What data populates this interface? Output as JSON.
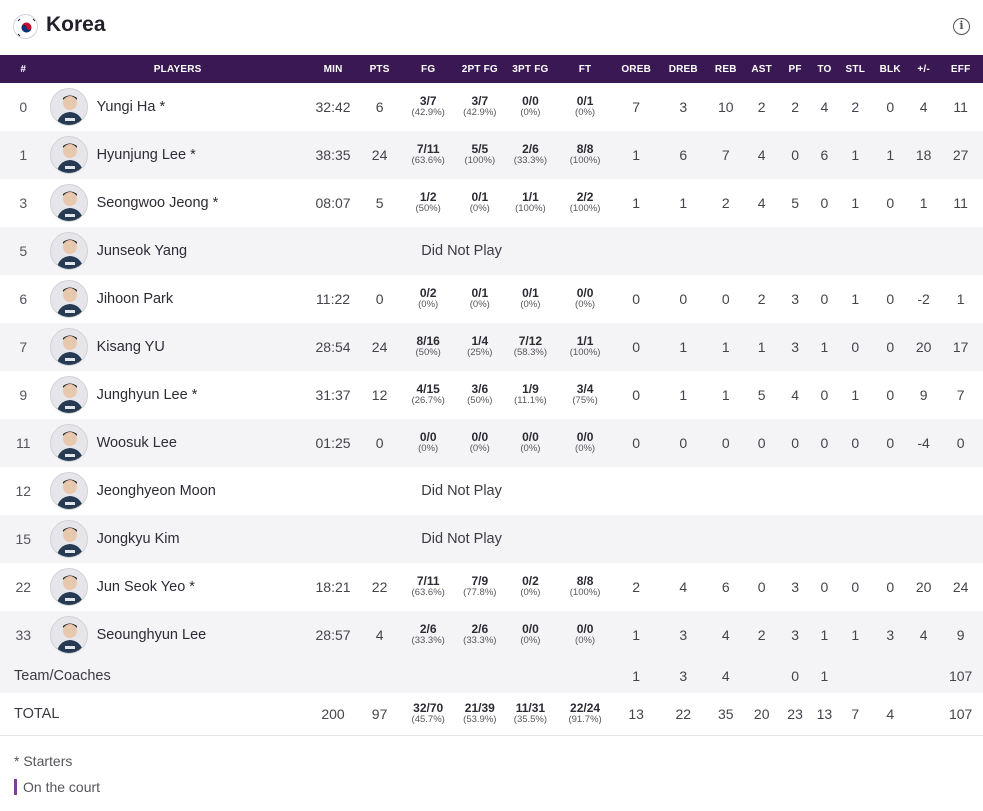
{
  "team": {
    "name": "Korea",
    "info_icon": "info-icon",
    "flag_icon": "korea-flag-icon"
  },
  "headers": [
    "#",
    "PLAYERS",
    "MIN",
    "PTS",
    "FG",
    "2PT FG",
    "3PT FG",
    "FT",
    "OREB",
    "DREB",
    "REB",
    "AST",
    "PF",
    "TO",
    "STL",
    "BLK",
    "+/-",
    "EFF"
  ],
  "players": [
    {
      "no": "0",
      "name": "Yungi Ha",
      "starter": true,
      "min": "32:42",
      "pts": "6",
      "fg": [
        "3/7",
        "(42.9%)"
      ],
      "fg2": [
        "3/7",
        "(42.9%)"
      ],
      "fg3": [
        "0/0",
        "(0%)"
      ],
      "ft": [
        "0/1",
        "(0%)"
      ],
      "oreb": "7",
      "dreb": "3",
      "reb": "10",
      "ast": "2",
      "pf": "2",
      "to": "4",
      "stl": "2",
      "blk": "0",
      "pm": "4",
      "eff": "11"
    },
    {
      "no": "1",
      "name": "Hyunjung Lee",
      "starter": true,
      "min": "38:35",
      "pts": "24",
      "fg": [
        "7/11",
        "(63.6%)"
      ],
      "fg2": [
        "5/5",
        "(100%)"
      ],
      "fg3": [
        "2/6",
        "(33.3%)"
      ],
      "ft": [
        "8/8",
        "(100%)"
      ],
      "oreb": "1",
      "dreb": "6",
      "reb": "7",
      "ast": "4",
      "pf": "0",
      "to": "6",
      "stl": "1",
      "blk": "1",
      "pm": "18",
      "eff": "27"
    },
    {
      "no": "3",
      "name": "Seongwoo Jeong",
      "starter": true,
      "min": "08:07",
      "pts": "5",
      "fg": [
        "1/2",
        "(50%)"
      ],
      "fg2": [
        "0/1",
        "(0%)"
      ],
      "fg3": [
        "1/1",
        "(100%)"
      ],
      "ft": [
        "2/2",
        "(100%)"
      ],
      "oreb": "1",
      "dreb": "1",
      "reb": "2",
      "ast": "4",
      "pf": "5",
      "to": "0",
      "stl": "1",
      "blk": "0",
      "pm": "1",
      "eff": "11"
    },
    {
      "no": "5",
      "name": "Junseok Yang",
      "starter": false,
      "dnp": "Did Not Play"
    },
    {
      "no": "6",
      "name": "Jihoon Park",
      "starter": false,
      "min": "11:22",
      "pts": "0",
      "fg": [
        "0/2",
        "(0%)"
      ],
      "fg2": [
        "0/1",
        "(0%)"
      ],
      "fg3": [
        "0/1",
        "(0%)"
      ],
      "ft": [
        "0/0",
        "(0%)"
      ],
      "oreb": "0",
      "dreb": "0",
      "reb": "0",
      "ast": "2",
      "pf": "3",
      "to": "0",
      "stl": "1",
      "blk": "0",
      "pm": "-2",
      "eff": "1"
    },
    {
      "no": "7",
      "name": "Kisang YU",
      "starter": false,
      "min": "28:54",
      "pts": "24",
      "fg": [
        "8/16",
        "(50%)"
      ],
      "fg2": [
        "1/4",
        "(25%)"
      ],
      "fg3": [
        "7/12",
        "(58.3%)"
      ],
      "ft": [
        "1/1",
        "(100%)"
      ],
      "oreb": "0",
      "dreb": "1",
      "reb": "1",
      "ast": "1",
      "pf": "3",
      "to": "1",
      "stl": "0",
      "blk": "0",
      "pm": "20",
      "eff": "17"
    },
    {
      "no": "9",
      "name": "Junghyun Lee",
      "starter": true,
      "min": "31:37",
      "pts": "12",
      "fg": [
        "4/15",
        "(26.7%)"
      ],
      "fg2": [
        "3/6",
        "(50%)"
      ],
      "fg3": [
        "1/9",
        "(11.1%)"
      ],
      "ft": [
        "3/4",
        "(75%)"
      ],
      "oreb": "0",
      "dreb": "1",
      "reb": "1",
      "ast": "5",
      "pf": "4",
      "to": "0",
      "stl": "1",
      "blk": "0",
      "pm": "9",
      "eff": "7"
    },
    {
      "no": "11",
      "name": "Woosuk Lee",
      "starter": false,
      "min": "01:25",
      "pts": "0",
      "fg": [
        "0/0",
        "(0%)"
      ],
      "fg2": [
        "0/0",
        "(0%)"
      ],
      "fg3": [
        "0/0",
        "(0%)"
      ],
      "ft": [
        "0/0",
        "(0%)"
      ],
      "oreb": "0",
      "dreb": "0",
      "reb": "0",
      "ast": "0",
      "pf": "0",
      "to": "0",
      "stl": "0",
      "blk": "0",
      "pm": "-4",
      "eff": "0"
    },
    {
      "no": "12",
      "name": "Jeonghyeon Moon",
      "starter": false,
      "dnp": "Did Not Play"
    },
    {
      "no": "15",
      "name": "Jongkyu Kim",
      "starter": false,
      "dnp": "Did Not Play"
    },
    {
      "no": "22",
      "name": "Jun Seok Yeo",
      "starter": true,
      "min": "18:21",
      "pts": "22",
      "fg": [
        "7/11",
        "(63.6%)"
      ],
      "fg2": [
        "7/9",
        "(77.8%)"
      ],
      "fg3": [
        "0/2",
        "(0%)"
      ],
      "ft": [
        "8/8",
        "(100%)"
      ],
      "oreb": "2",
      "dreb": "4",
      "reb": "6",
      "ast": "0",
      "pf": "3",
      "to": "0",
      "stl": "0",
      "blk": "0",
      "pm": "20",
      "eff": "24"
    },
    {
      "no": "33",
      "name": "Seounghyun Lee",
      "starter": false,
      "min": "28:57",
      "pts": "4",
      "fg": [
        "2/6",
        "(33.3%)"
      ],
      "fg2": [
        "2/6",
        "(33.3%)"
      ],
      "fg3": [
        "0/0",
        "(0%)"
      ],
      "ft": [
        "0/0",
        "(0%)"
      ],
      "oreb": "1",
      "dreb": "3",
      "reb": "4",
      "ast": "2",
      "pf": "3",
      "to": "1",
      "stl": "1",
      "blk": "3",
      "pm": "4",
      "eff": "9"
    }
  ],
  "team_row": {
    "label": "Team/Coaches",
    "oreb": "1",
    "dreb": "3",
    "reb": "4",
    "pf": "0",
    "to": "1",
    "eff": "107"
  },
  "total_row": {
    "label": "TOTAL",
    "min": "200",
    "pts": "97",
    "fg": [
      "32/70",
      "(45.7%)"
    ],
    "fg2": [
      "21/39",
      "(53.9%)"
    ],
    "fg3": [
      "11/31",
      "(35.5%)"
    ],
    "ft": [
      "22/24",
      "(91.7%)"
    ],
    "oreb": "13",
    "dreb": "22",
    "reb": "35",
    "ast": "20",
    "pf": "23",
    "to": "13",
    "stl": "7",
    "blk": "4",
    "eff": "107"
  },
  "legend": {
    "starters": "* Starters",
    "on_court": "On the court"
  },
  "colors": {
    "header_bg": "#3a1853",
    "on_court": "#7d3f98",
    "stripe": "#f4f4f6"
  }
}
